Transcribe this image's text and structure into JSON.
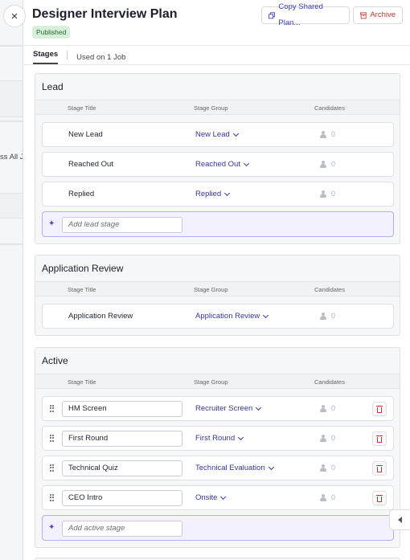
{
  "window": {
    "close_icon": "×"
  },
  "background": {
    "partial_text": "ss All Jo"
  },
  "header": {
    "title": "Designer Interview Plan",
    "status_badge": "Published",
    "copy_button": "Copy Shared Plan...",
    "archive_button": "Archive"
  },
  "tabs": [
    {
      "label": "Stages",
      "active": true
    },
    {
      "label": "Used on 1 Job",
      "active": false
    }
  ],
  "columns": {
    "title": "Stage Title",
    "group": "Stage Group",
    "candidates": "Candidates"
  },
  "sections": {
    "lead": {
      "title": "Lead",
      "stages": [
        {
          "title": "New Lead",
          "group": "New Lead",
          "candidates": "0"
        },
        {
          "title": "Reached Out",
          "group": "Reached Out",
          "candidates": "0"
        },
        {
          "title": "Replied",
          "group": "Replied",
          "candidates": "0"
        }
      ],
      "add_placeholder": "Add lead stage"
    },
    "application_review": {
      "title": "Application Review",
      "stages": [
        {
          "title": "Application Review",
          "group": "Application Review",
          "candidates": "0"
        }
      ]
    },
    "active": {
      "title": "Active",
      "stages": [
        {
          "title": "HM Screen",
          "group": "Recruiter Screen",
          "candidates": "0"
        },
        {
          "title": "First Round",
          "group": "First Round",
          "candidates": "0"
        },
        {
          "title": "Technical Quiz",
          "group": "Technical Evaluation",
          "candidates": "0"
        },
        {
          "title": "CEO Intro",
          "group": "Onsite",
          "candidates": "0"
        }
      ],
      "add_placeholder": "Add active stage"
    }
  },
  "colors": {
    "accent": "#35359f",
    "danger": "#c0362c",
    "badge_bg": "#d8efd9",
    "badge_text": "#236b31"
  }
}
